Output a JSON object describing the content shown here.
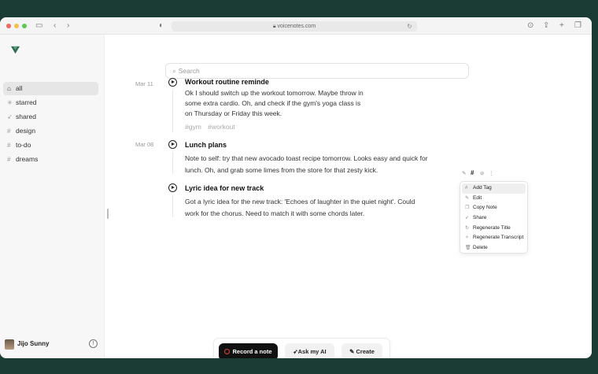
{
  "browser": {
    "url": "voicenotes.com",
    "lock_icon": "lock-icon",
    "colors": {
      "close": "#ec6a5e",
      "minimize": "#f4bf4f",
      "zoom": "#61c554"
    }
  },
  "sidebar": {
    "items": [
      {
        "label": "all",
        "icon": "home-icon",
        "active": true
      },
      {
        "label": "starred",
        "icon": "star-icon"
      },
      {
        "label": "shared",
        "icon": "send-icon"
      },
      {
        "label": "design",
        "icon": "hash-icon"
      },
      {
        "label": "to-do",
        "icon": "hash-icon"
      },
      {
        "label": "dreams",
        "icon": "hash-icon"
      }
    ],
    "user": {
      "name": "Jijo Sunny"
    }
  },
  "search": {
    "placeholder": "Search"
  },
  "notes": [
    {
      "date": "Mar 11",
      "title": "Workout routine reminde",
      "lines": [
        "Ok I should switch up the workout tomorrow. Maybe throw in",
        "some extra cardio. Oh, and check if the gym's yoga class is",
        "on Thursday or Friday this week."
      ],
      "tags": [
        "#gym",
        "#workout"
      ]
    },
    {
      "date": "Mar 08",
      "title": "Lunch plans",
      "lines": [
        "Note to self: try that new avocado toast recipe tomorrow. Looks easy and quick for",
        "lunch. Oh, and grab some limes from the store for that zesty kick."
      ]
    },
    {
      "date": "",
      "title": "Lyric idea for new track",
      "lines": [
        "Got a lyric idea for the new track: 'Echoes of laughter in the quiet night'. Could",
        "work for the chorus. Need to match it with some chords later."
      ]
    }
  ],
  "context_menu": {
    "items": [
      {
        "label": "Add Tag",
        "icon": "hash-icon",
        "highlighted": true
      },
      {
        "label": "Edit",
        "icon": "pencil-icon"
      },
      {
        "label": "Copy Note",
        "icon": "copy-icon"
      },
      {
        "label": "Share",
        "icon": "send-icon"
      },
      {
        "label": "Regenerate Title",
        "icon": "refresh-icon"
      },
      {
        "label": "Regenerate Transcript",
        "icon": "sparkle-icon"
      },
      {
        "label": "Delete",
        "icon": "trash-icon"
      }
    ]
  },
  "actions": {
    "record": "Record a note",
    "ask_ai": "Ask my AI",
    "create": "Create",
    "record_color": "#e0443c"
  }
}
